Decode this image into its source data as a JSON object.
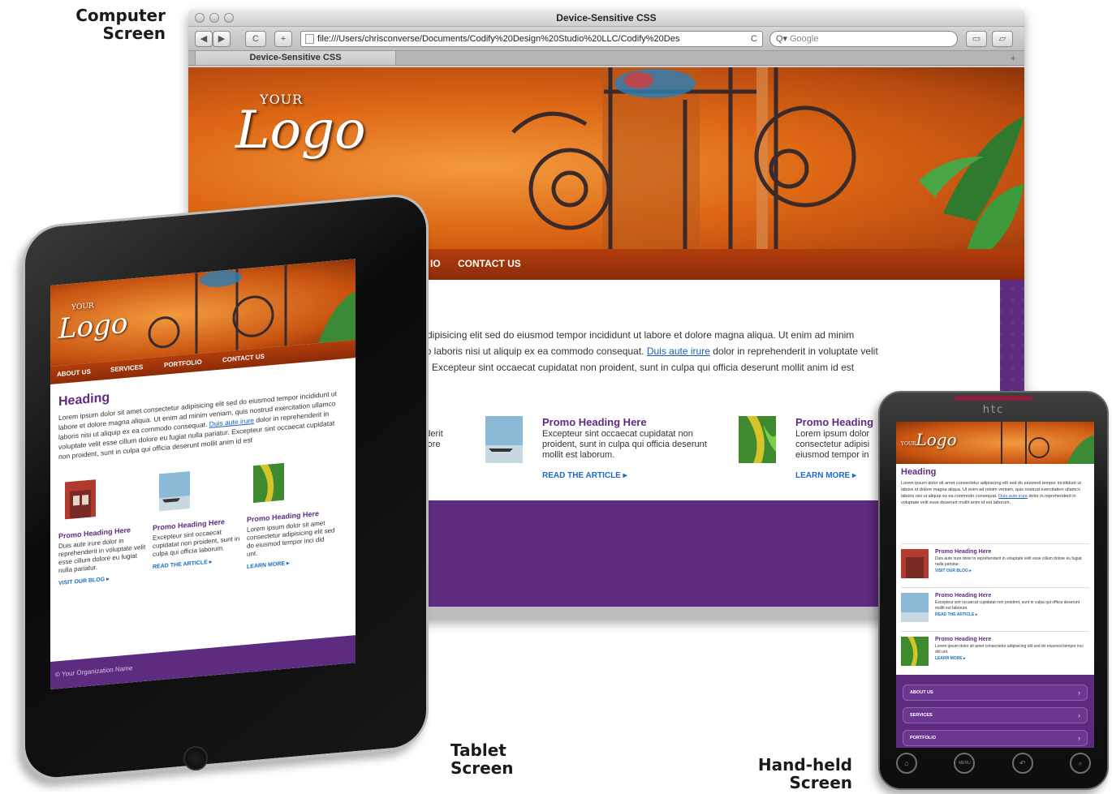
{
  "labels": {
    "computer_line1": "Computer",
    "computer_line2": "Screen",
    "tablet_line1": "Tablet",
    "tablet_line2": "Screen",
    "handheld_line1": "Hand-held",
    "handheld_line2": "Screen"
  },
  "browser": {
    "window_title": "Device-Sensitive CSS",
    "url": "file:///Users/chrisconverse/Documents/Codify%20Design%20Studio%20LLC/Codify%20Des",
    "search_placeholder": "Google",
    "tab_title": "Device-Sensitive CSS",
    "back_icon": "◀",
    "forward_icon": "▶",
    "reload_icon": "C",
    "add_icon": "+",
    "tab_add_icon": "+"
  },
  "site": {
    "logo_your": "YOUR",
    "logo_word": "Logo",
    "nav_visible": [
      "IO",
      "CONTACT US"
    ],
    "body_line1": "r adipisicing elit sed do eiusmod tempor incididunt ut labore et dolore magna aliqua. Ut enim ad minim",
    "body_line2_before": "nco laboris nisi ut aliquip ex ea commodo consequat. ",
    "body_link": "Duis aute irure",
    "body_line2_after": " dolor in reprehenderit in voluptate velit",
    "body_line3": "tur. Excepteur sint occaecat cupidatat non proident, sunt in culpa qui officia deserunt mollit anim id est",
    "promo_partial_text": "enderit\ndolore",
    "promos": [
      {
        "heading": "Promo Heading Here",
        "text": "Excepteur sint occaecat cupidatat non proident, sunt in culpa qui officia deserunt mollit est laborum.",
        "more": "READ THE ARTICLE ▸"
      },
      {
        "heading": "Promo Heading",
        "text": "Lorem ipsum dolor consectetur adipisi eiusmod tempor in",
        "more": "LEARN MORE ▸"
      }
    ]
  },
  "tablet": {
    "logo_your": "YOUR",
    "logo_word": "Logo",
    "nav": [
      "ABOUT US",
      "SERVICES",
      "PORTFOLIO",
      "CONTACT US"
    ],
    "heading": "Heading",
    "text_before": "Lorem ipsum dolor sit amet consectetur adipisicing elit sed do eiusmod tempor incididunt ut labore et dolore magna aliqua. Ut enim ad minim veniam, quis nostrud exercitation ullamco laboris nisi ut aliquip ex ea commodo consequat. ",
    "text_link": "Duis aute irure",
    "text_after": " dolor in reprehenderit in voluptate velit esse cillum dolore eu fugiat nulla pariatur. Excepteur sint occaecat cupidatat non proident, sunt in culpa qui officia deserunt mollit anim id est",
    "promos": [
      {
        "heading": "Promo Heading Here",
        "text": "Duis aute irure dolor in reprehenderit in voluptate velit esse cillum dolore eu fugiat nulla pariatur.",
        "more": "VISIT OUR BLOG ▸"
      },
      {
        "heading": "Promo Heading Here",
        "text": "Excepteur sint occaecat cupidatat non proident, sunt in culpa qui officia laborum.",
        "more": "READ THE ARTICLE ▸"
      },
      {
        "heading": "Promo Heading Here",
        "text": "Lorem ipsum dolor sit amet consectetur adipisicing elit sed do eiusmod tempor inci did unt.",
        "more": "LEARN MORE ▸"
      }
    ],
    "footer": "© Your Organization Name"
  },
  "phone": {
    "brand": "htc",
    "logo_your": "YOUR",
    "logo_word": "Logo",
    "heading": "Heading",
    "text_before": "Lorem ipsum dolor sit amet consectetur adipisicing elit sed do eiusmod tempor incididunt ut labore et dolore magna aliqua. Ut enim ad minim veniam, quis nostrud exercitation ullamco laboris nisi ut aliquip ex ea commodo consequat. ",
    "text_link": "Duis aute irure",
    "text_after": " dolor in reprehenderit in voluptate velit esse deserunt mollit anim id est laborum.",
    "promos": [
      {
        "heading": "Promo Heading Here",
        "text": "Duis aute irure dolor in reprehenderit in voluptate velit esse cillum dolore eu fugiat nulla pariatur.",
        "more": "VISIT OUR BLOG ▸"
      },
      {
        "heading": "Promo Heading Here",
        "text": "Excepteur sint occaecat cupidatat non proident, sunt in culpa qui officia deserunt mollit est laborum.",
        "more": "READ THE ARTICLE ▸"
      },
      {
        "heading": "Promo Heading Here",
        "text": "Lorem ipsum dolor sit amet consectetur adipisicing elit sed do eiusmod tempor inci did unt.",
        "more": "LEARN MORE ▸"
      }
    ],
    "menu": [
      "ABOUT US",
      "SERVICES",
      "PORTFOLIO"
    ],
    "keys": [
      "home-icon",
      "menu-icon",
      "back-icon",
      "search-icon"
    ],
    "menu_key_label": "MENU"
  },
  "colors": {
    "purple": "#5d2b80",
    "orange": "#dd6715",
    "nav_rust": "#a0350a",
    "link_blue": "#1a6dc3"
  }
}
